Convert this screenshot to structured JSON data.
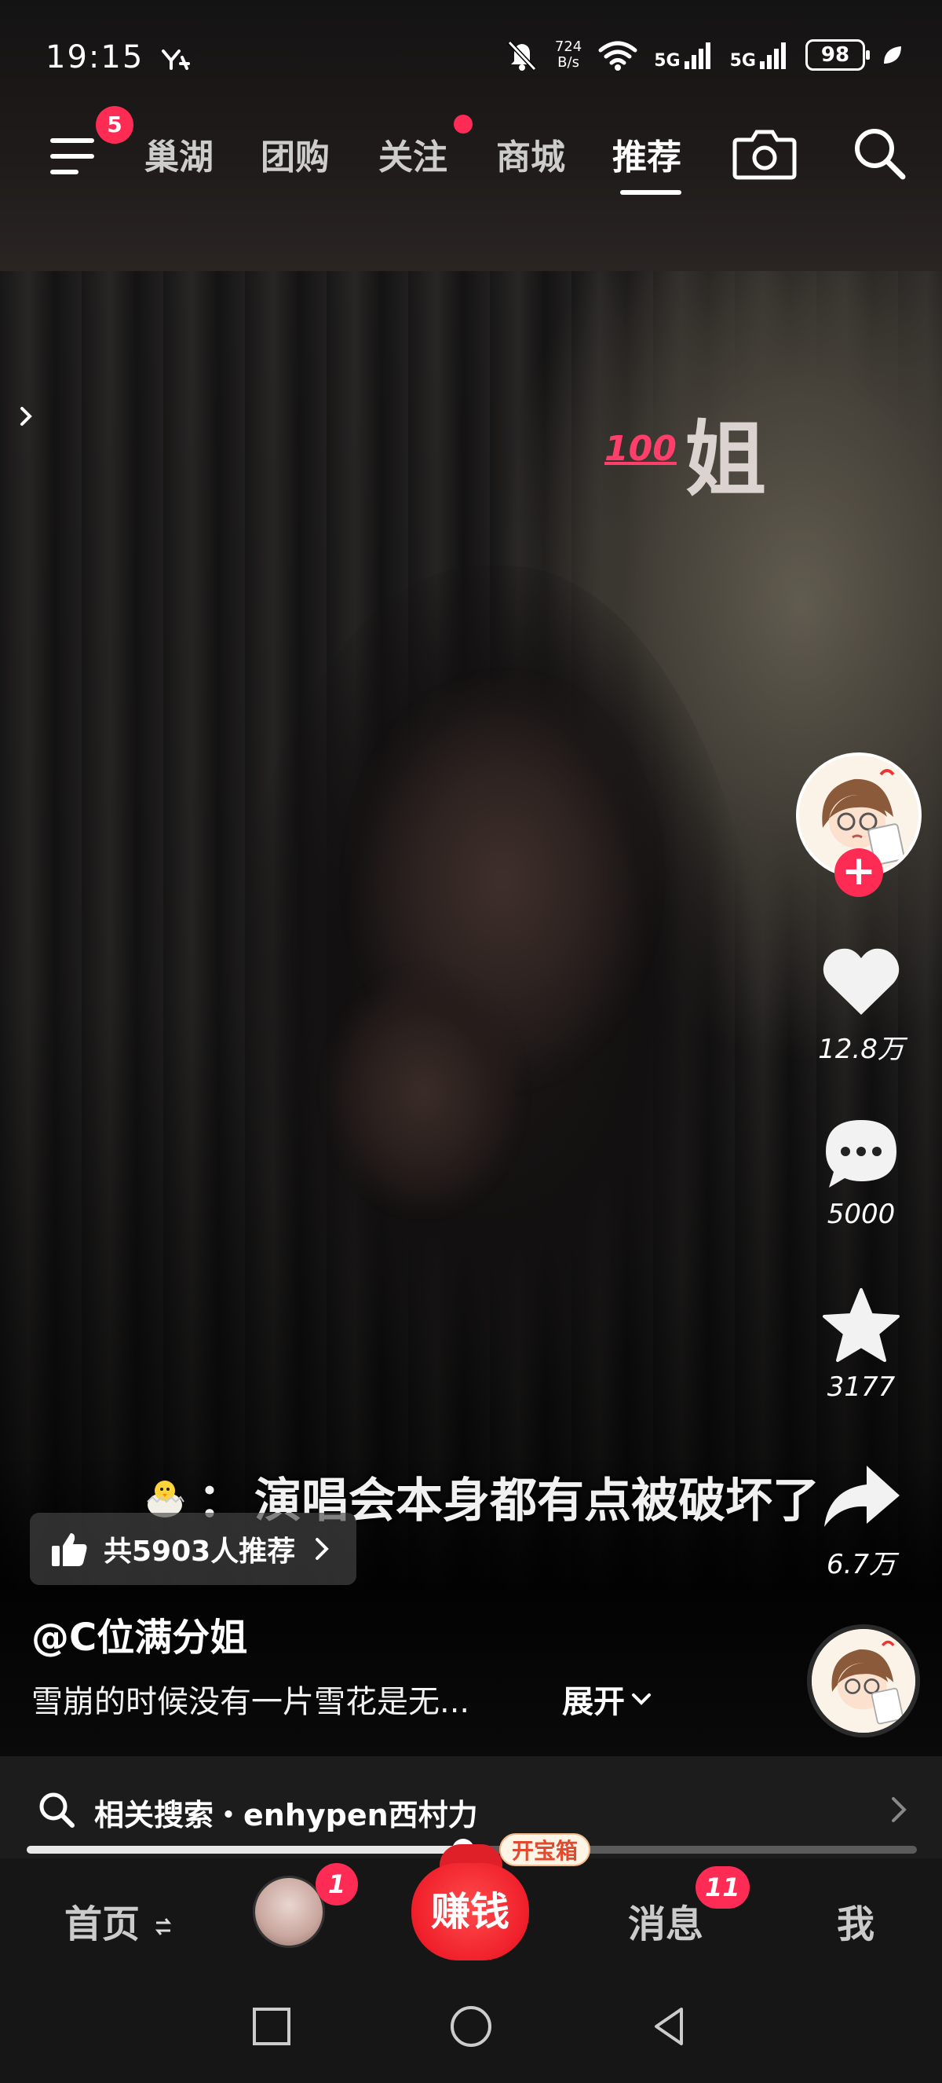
{
  "status_bar": {
    "time": "19:15",
    "net_speed_value": "724",
    "net_speed_unit": "B/s",
    "signal_1": "5G",
    "signal_2": "5G",
    "battery": "98"
  },
  "top_nav": {
    "menu_badge": "5",
    "tabs": [
      "巢湖",
      "团购",
      "关注",
      "商城",
      "推荐"
    ],
    "active_tab": "推荐"
  },
  "video": {
    "overlay_emoji_text": "100",
    "overlay_text": "姐",
    "subtitle": "演唱会本身都有点被破坏了",
    "subtitle_prefix": "："
  },
  "right_rail": {
    "like_count": "12.8万",
    "comment_count": "5000",
    "favorite_count": "3177",
    "share_count": "6.7万"
  },
  "recommendation": {
    "text": "共5903人推荐"
  },
  "post": {
    "author": "@C位满分姐",
    "caption": "雪崩的时候没有一片雪花是无...",
    "expand_label": "展开"
  },
  "related_search": {
    "text": "相关搜索・enhypen西村力"
  },
  "progress": {
    "fraction": 0.49
  },
  "bottom_tabs": {
    "home": "首页",
    "friend_badge": "1",
    "earn": "赚钱",
    "treasure": "开宝箱",
    "messages": "消息",
    "messages_badge": "11",
    "me": "我"
  },
  "colors": {
    "accent": "#fe2c55",
    "earn": "#f0202b"
  }
}
